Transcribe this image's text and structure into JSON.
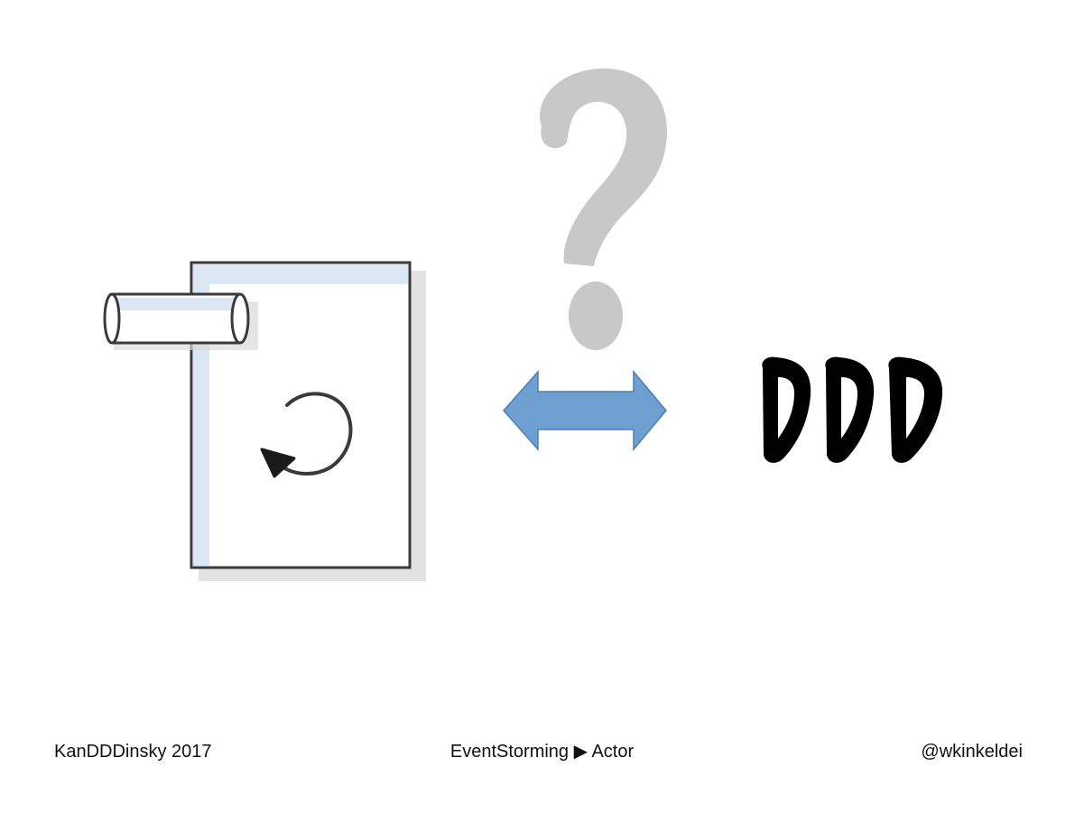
{
  "slide": {
    "footer": {
      "event": "KanDDDinsky 2017",
      "breadcrumb": "EventStorming ▶ Actor",
      "handle": "@wkinkeldei"
    },
    "graphic": {
      "ddd_label": "DDD",
      "question_mark": "?",
      "colors": {
        "arrow_fill": "#6f9fd0",
        "arrow_stroke": "#4d7fb8",
        "question_gray": "#c8c8c8",
        "document_stroke": "#3a3a3a",
        "document_tint": "#dbe8f4",
        "ddd_black": "#000000"
      },
      "icons": {
        "document": "process-document-icon",
        "pipe": "database-pipe-icon",
        "cycle": "refresh-cycle-icon",
        "arrow": "double-arrow-icon",
        "question": "question-mark-icon"
      }
    }
  }
}
